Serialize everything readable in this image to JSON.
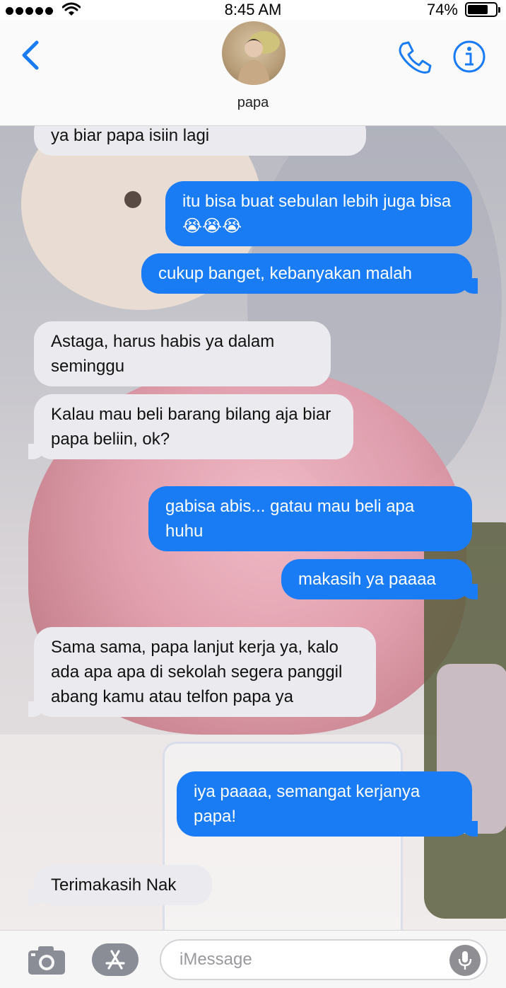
{
  "status_bar": {
    "time": "8:45 AM",
    "battery_percent": "74%",
    "battery_level": 0.74,
    "signal_dots": 5,
    "icons": [
      "signal-dots-icon",
      "wifi-icon",
      "battery-icon"
    ]
  },
  "header": {
    "contact_name": "papa",
    "icons": [
      "back-chevron-icon",
      "phone-icon",
      "info-icon"
    ],
    "accent_color": "#1a7cf5"
  },
  "messages": [
    {
      "side": "incoming",
      "text": "ya biar papa isiin lagi"
    },
    {
      "side": "outgoing",
      "text": "itu bisa buat sebulan lebih juga bisa😭😭😭"
    },
    {
      "side": "outgoing",
      "text": "cukup banget, kebanyakan malah"
    },
    {
      "side": "incoming",
      "text": "Astaga, harus habis ya dalam seminggu"
    },
    {
      "side": "incoming",
      "text": "Kalau mau beli barang bilang aja biar papa beliin, ok?"
    },
    {
      "side": "outgoing",
      "text": "gabisa abis... gatau mau beli apa huhu"
    },
    {
      "side": "outgoing",
      "text": "makasih ya paaaa"
    },
    {
      "side": "incoming",
      "text": "Sama sama, papa lanjut kerja ya, kalo ada apa apa di sekolah segera panggil abang kamu atau telfon papa ya"
    },
    {
      "side": "outgoing",
      "text": "iya paaaa, semangat kerjanya papa!"
    },
    {
      "side": "incoming",
      "text": "Terimakasih Nak"
    }
  ],
  "input_bar": {
    "placeholder": "iMessage",
    "value": "",
    "icons": [
      "camera-icon",
      "app-store-icon",
      "microphone-icon"
    ]
  },
  "colors": {
    "outgoing_bubble": "#1a7cf5",
    "incoming_bubble": "#ebeaee"
  }
}
